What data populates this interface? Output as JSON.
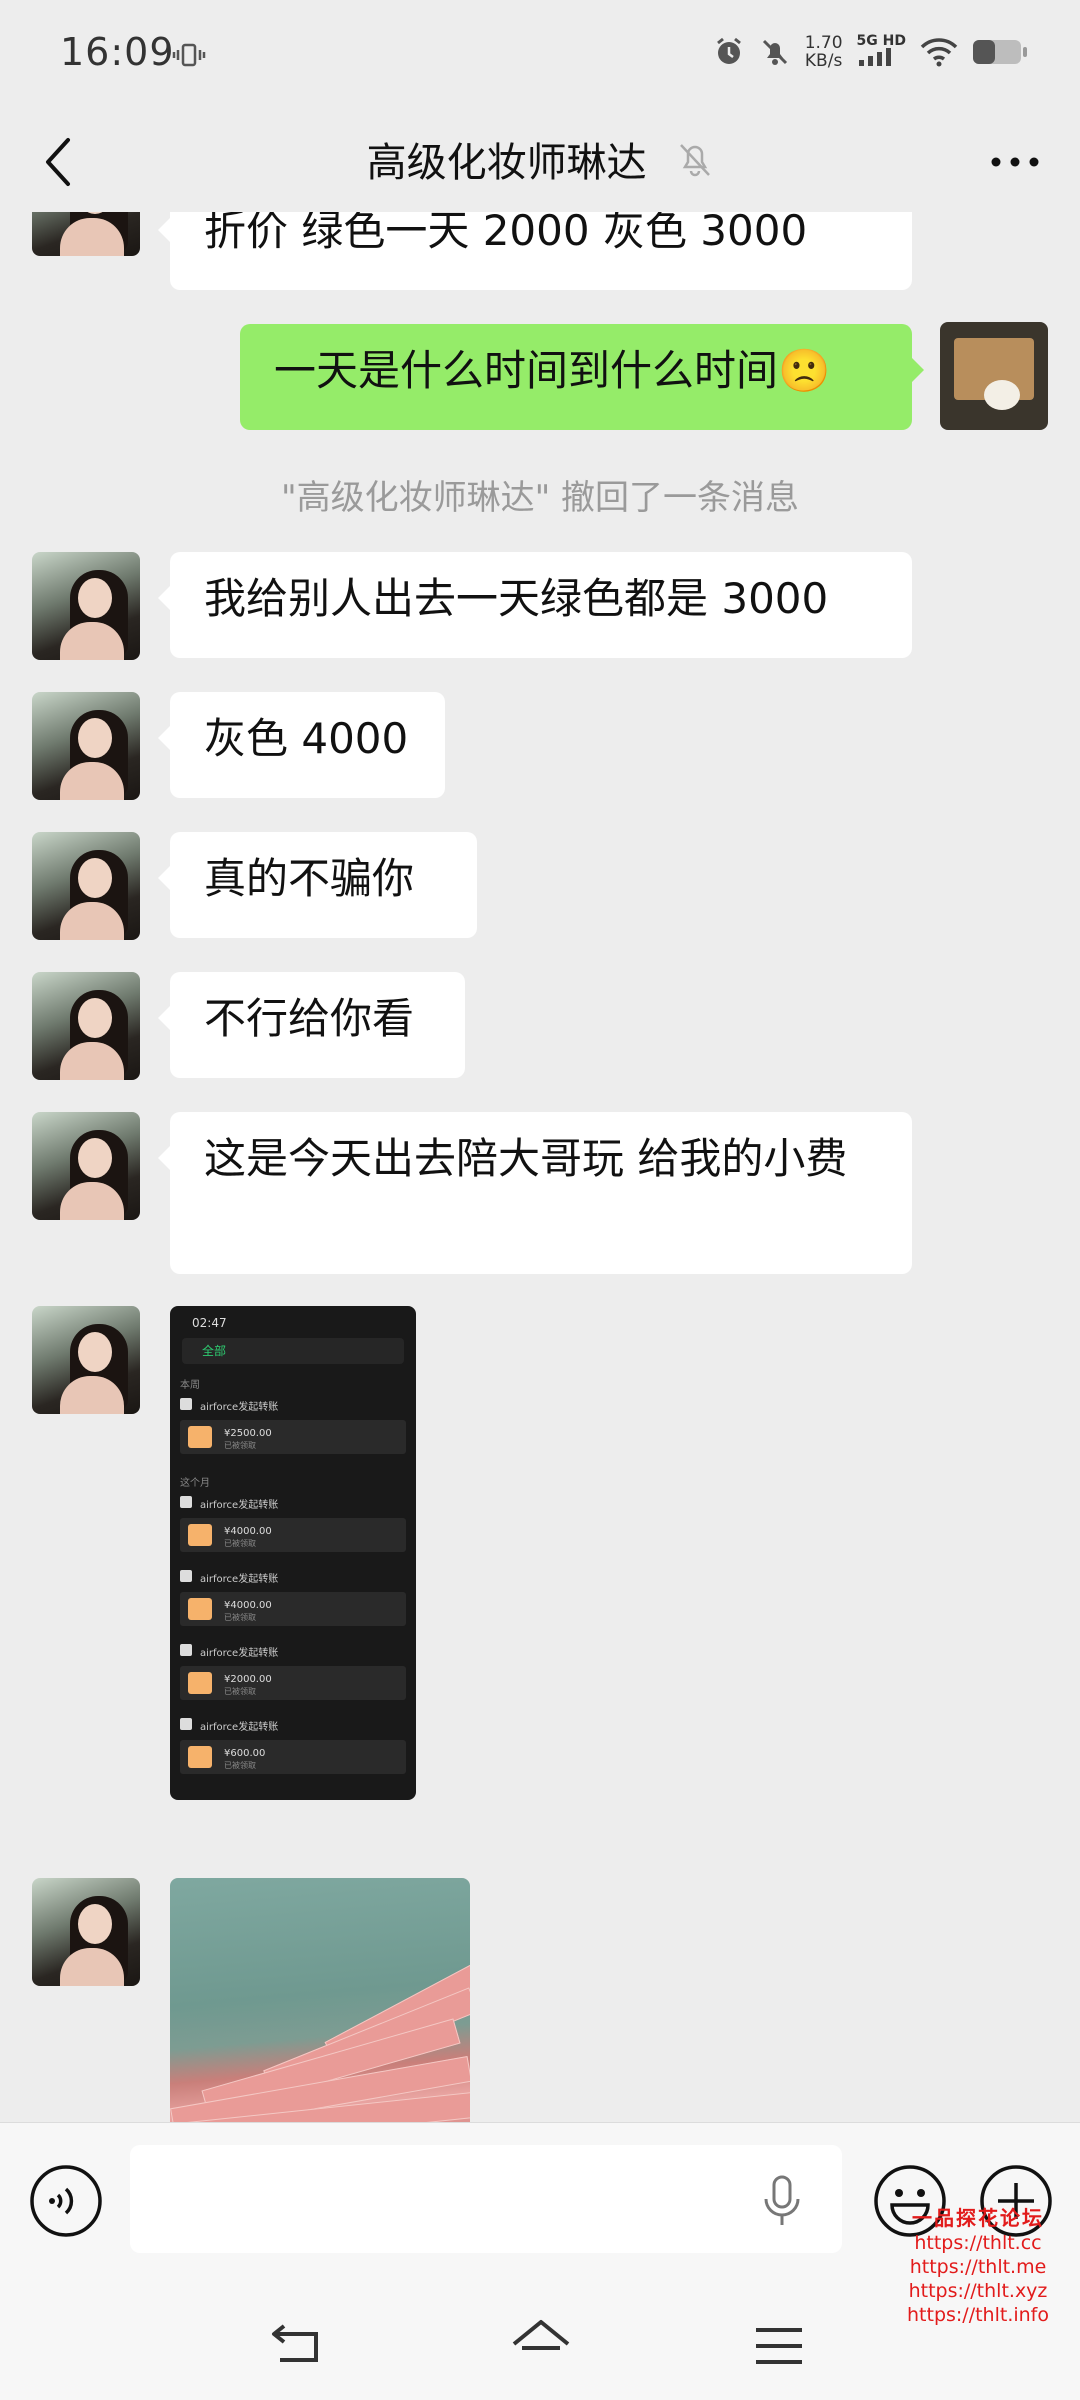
{
  "status_bar": {
    "time": "16:09",
    "net_speed_value": "1.70",
    "net_speed_unit": "KB/s",
    "network": "5G HD"
  },
  "header": {
    "title": "高级化妆师琳达"
  },
  "messages": [
    {
      "side": "left",
      "text": "折价 绿色一天 2000 灰色 3000"
    },
    {
      "side": "right",
      "text": "一天是什么时间到什么时间🙁"
    },
    {
      "type": "system",
      "text": "\"高级化妆师琳达\" 撤回了一条消息"
    },
    {
      "side": "left",
      "text": "我给别人出去一天绿色都是 3000"
    },
    {
      "side": "left",
      "text": "灰色 4000"
    },
    {
      "side": "left",
      "text": "真的不骗你"
    },
    {
      "side": "left",
      "text": "不行给你看"
    },
    {
      "side": "left",
      "text": "这是今天出去陪大哥玩 给我的小费"
    }
  ],
  "screenshot_image": {
    "status_time": "02:47",
    "search_label": "全部",
    "sections": [
      "本周",
      "这个月"
    ],
    "rows": [
      {
        "title": "airforce发起转账",
        "amount": "¥2500.00",
        "sub": "已被领取"
      },
      {
        "title": "airforce发起转账",
        "amount": "¥4000.00",
        "sub": "已被领取"
      },
      {
        "title": "airforce发起转账",
        "amount": "¥4000.00",
        "sub": "已被领取"
      },
      {
        "title": "airforce发起转账",
        "amount": "¥2000.00",
        "sub": "已被领取"
      },
      {
        "title": "airforce发起转账",
        "amount": "¥600.00",
        "sub": "已被领取"
      }
    ]
  },
  "watermark": {
    "title": "一品探花论坛",
    "urls": [
      "https://thlt.cc",
      "https://thlt.me",
      "https://thlt.xyz",
      "https://thlt.info"
    ]
  },
  "colors": {
    "background": "#ededed",
    "my_bubble": "#95ec69",
    "their_bubble": "#ffffff",
    "watermark": "#e21b1b"
  },
  "icons": {
    "back": "chevron-left-icon",
    "mute": "bell-off-icon",
    "more": "more-dots-icon",
    "voice": "voice-icon",
    "mic": "microphone-icon",
    "emoji": "emoji-icon",
    "plus": "plus-icon"
  }
}
